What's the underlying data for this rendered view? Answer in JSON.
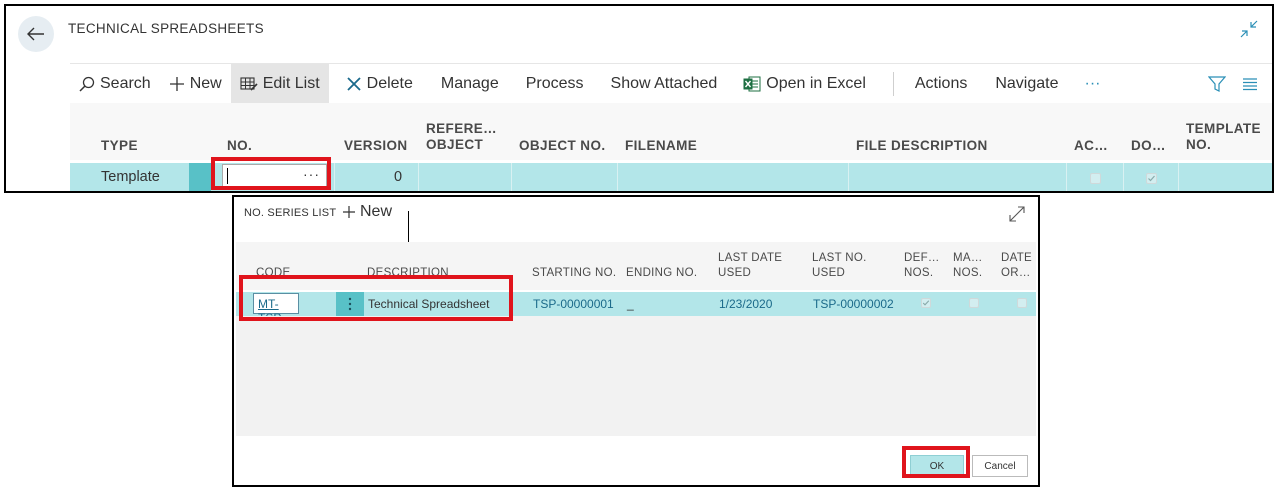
{
  "page": {
    "title": "TECHNICAL SPREADSHEETS"
  },
  "toolbar": {
    "search": "Search",
    "new": "New",
    "edit_list": "Edit List",
    "delete": "Delete",
    "manage": "Manage",
    "process": "Process",
    "show_attached": "Show Attached",
    "open_in_excel": "Open in Excel",
    "actions": "Actions",
    "navigate": "Navigate",
    "more": "···"
  },
  "main_table": {
    "columns": {
      "type": "TYPE",
      "no": "NO.",
      "version": "VERSION",
      "reference_object_1": "REFERE…",
      "reference_object_2": "OBJECT",
      "object_no": "OBJECT NO.",
      "filename": "FILENAME",
      "file_description": "FILE DESCRIPTION",
      "ac": "AC…",
      "do": "DO…",
      "template_no_1": "TEMPLATE",
      "template_no_2": "NO."
    },
    "row": {
      "type": "Template",
      "no": "",
      "no_lookup": "···",
      "version": "0",
      "ac_checked": false,
      "do_checked": true
    }
  },
  "dialog": {
    "title": "NO. SERIES LIST",
    "new": "New",
    "columns": {
      "code": "CODE",
      "description": "DESCRIPTION",
      "starting_no": "STARTING NO.",
      "ending_no": "ENDING NO.",
      "last_date_used_1": "LAST DATE",
      "last_date_used_2": "USED",
      "last_no_used_1": "LAST NO.",
      "last_no_used_2": "USED",
      "def_nos_1": "DEF…",
      "def_nos_2": "NOS.",
      "ma_nos_1": "MA…",
      "ma_nos_2": "NOS.",
      "date_or_1": "DATE",
      "date_or_2": "OR…"
    },
    "row": {
      "code": "MT-TSP",
      "description": "Technical Spreadsheet",
      "starting_no": "TSP-00000001",
      "ending_no": "_",
      "last_date_used": "1/23/2020",
      "last_no_used": "TSP-00000002",
      "default_nos": true,
      "manual_nos": false,
      "date_order": false
    },
    "ok": "OK",
    "cancel": "Cancel"
  },
  "colors": {
    "selected_row": "#b3e6e9",
    "accent": "#00a4b4",
    "highlight": "#e0141c"
  }
}
